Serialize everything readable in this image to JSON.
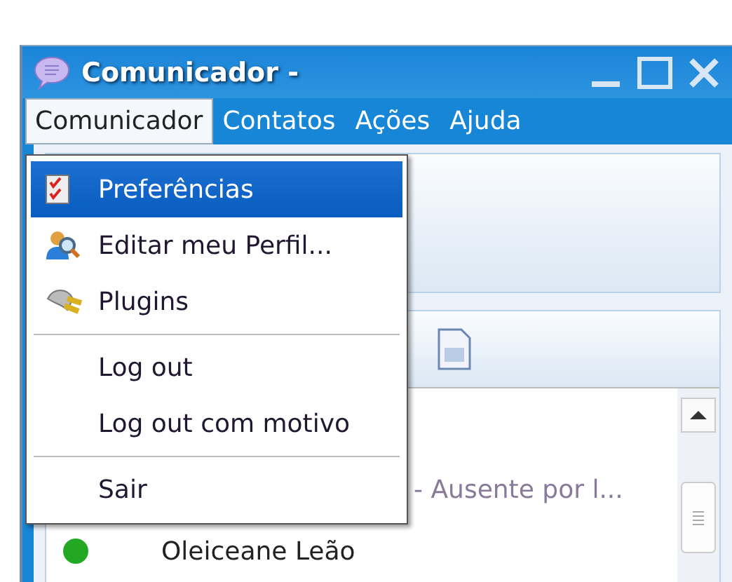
{
  "window": {
    "title": "Comunicador -"
  },
  "menubar": [
    {
      "label": "Comunicador",
      "selected": true
    },
    {
      "label": "Contatos",
      "selected": false
    },
    {
      "label": "Ações",
      "selected": false
    },
    {
      "label": "Ajuda",
      "selected": false
    }
  ],
  "menu": [
    {
      "kind": "checklist",
      "label": "Preferências",
      "selected": true
    },
    {
      "kind": "profile",
      "label": "Editar meu Perfil...",
      "selected": false
    },
    {
      "kind": "plug",
      "label": "Plugins",
      "selected": false
    },
    {
      "kind": "separator"
    },
    {
      "kind": "item",
      "label": "Log out",
      "selected": false
    },
    {
      "kind": "item",
      "label": "Log out com motivo",
      "selected": false
    },
    {
      "kind": "separator"
    },
    {
      "kind": "item",
      "label": "Sair",
      "selected": false
    }
  ],
  "contacts": [
    {
      "status_message": "- Ausente por l..."
    },
    {
      "name": "Oleiceane Leão",
      "color": "#22a822"
    }
  ]
}
